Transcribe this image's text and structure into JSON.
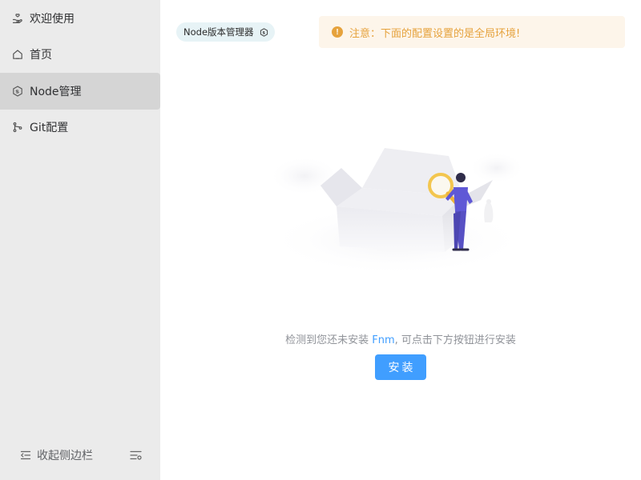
{
  "sidebar": {
    "items": [
      {
        "label": "欢迎使用",
        "icon": "hand-heart-icon"
      },
      {
        "label": "首页",
        "icon": "home-icon"
      },
      {
        "label": "Node管理",
        "icon": "nodejs-icon"
      },
      {
        "label": "Git配置",
        "icon": "git-branch-icon"
      }
    ],
    "active_index": 2,
    "collapse_label": "收起侧边栏"
  },
  "main": {
    "tag_label": "Node版本管理器",
    "tag_icon": "nodejs-icon",
    "alert_text": "注意：下面的配置设置的是全局环境!",
    "alert_icon": "warning-icon",
    "message_before": "检测到您还未安装 ",
    "message_highlight": "Fnm",
    "message_after": ", 可点击下方按钮进行安装",
    "install_label": "安装",
    "illustration": "empty-box-illustration"
  },
  "colors": {
    "sidebar_bg": "#ebebeb",
    "active_bg": "#d5d5d5",
    "primary": "#409eff",
    "warning": "#e6a23c",
    "warning_bg": "#fdf5ea",
    "tag_bg": "#e7f3f6"
  }
}
